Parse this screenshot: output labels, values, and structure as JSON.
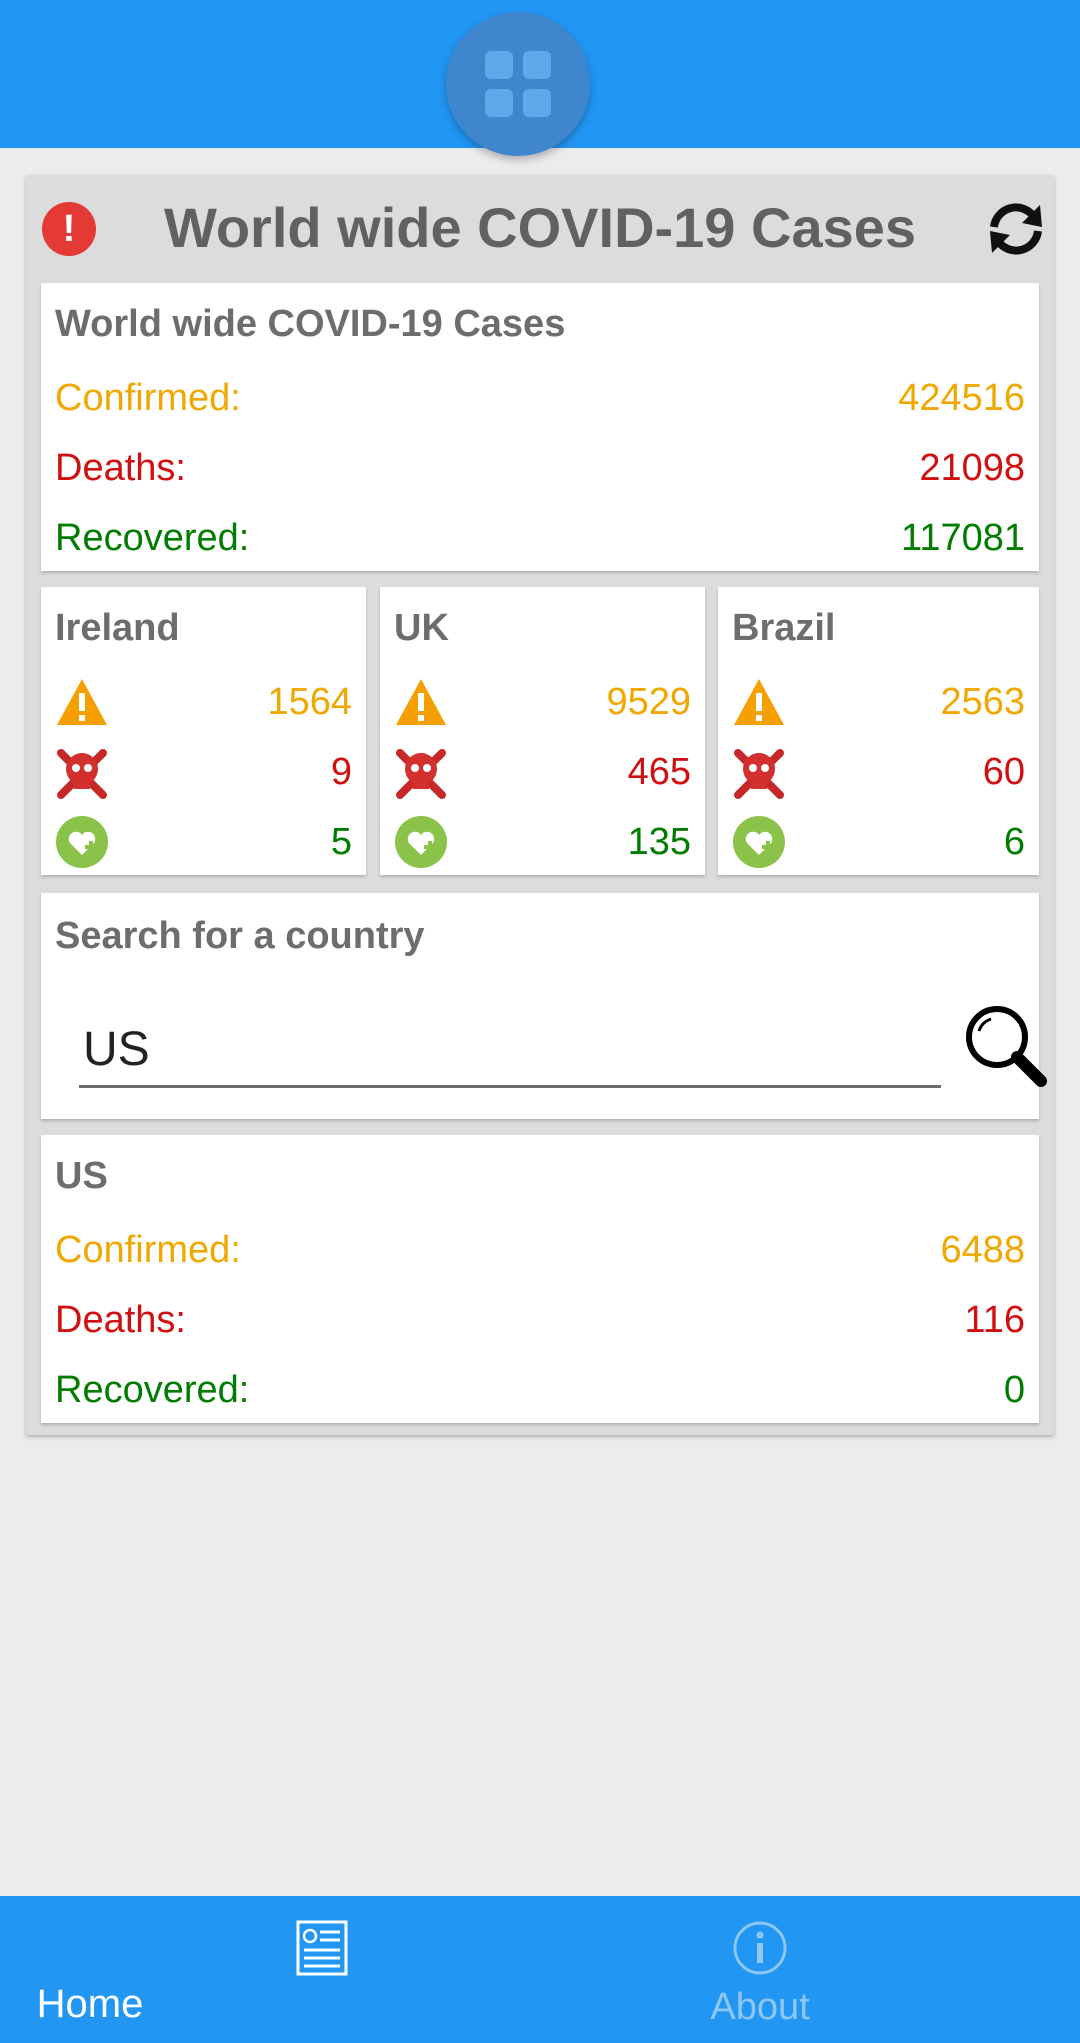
{
  "header": {
    "fab_icon": "grid-icon"
  },
  "panel": {
    "title": "World wide COVID-19 Cases",
    "alert_icon": "alert-icon",
    "refresh_icon": "refresh-icon"
  },
  "worldwide": {
    "title": "World wide COVID-19 Cases",
    "confirmed_label": "Confirmed:",
    "confirmed": "424516",
    "deaths_label": "Deaths:",
    "deaths": "21098",
    "recovered_label": "Recovered:",
    "recovered": "117081"
  },
  "countries": [
    {
      "name": "Ireland",
      "confirmed": "1564",
      "deaths": "9",
      "recovered": "5"
    },
    {
      "name": "UK",
      "confirmed": "9529",
      "deaths": "465",
      "recovered": "135"
    },
    {
      "name": "Brazil",
      "confirmed": "2563",
      "deaths": "60",
      "recovered": "6"
    }
  ],
  "search": {
    "title": "Search for a country",
    "value": "US"
  },
  "result": {
    "title": "US",
    "confirmed_label": "Confirmed:",
    "confirmed": "6488",
    "deaths_label": "Deaths:",
    "deaths": "116",
    "recovered_label": "Recovered:",
    "recovered": "0"
  },
  "nav": {
    "home_label": "Home",
    "about_label": "About"
  },
  "colors": {
    "primary": "#2196f3",
    "confirmed": "#f0a800",
    "deaths": "#d01010",
    "recovered": "#007d00"
  }
}
